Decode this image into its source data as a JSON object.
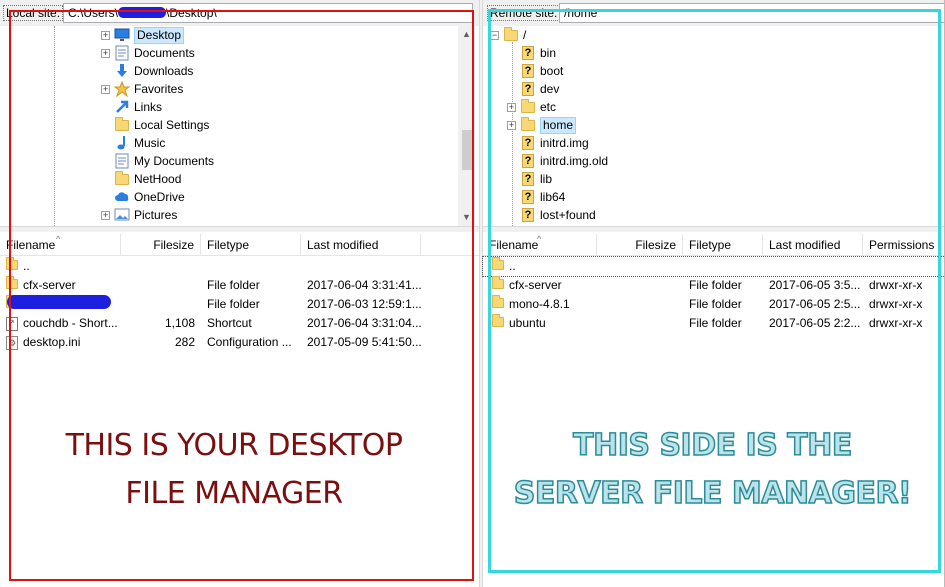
{
  "local": {
    "site_label": "Local site:",
    "path_prefix": "C:\\Users\\",
    "path_suffix": "\\Desktop\\",
    "tree": [
      {
        "label": "Desktop",
        "icon": "desktop-icon",
        "expandable": true,
        "selected": true
      },
      {
        "label": "Documents",
        "icon": "documents-icon",
        "expandable": true
      },
      {
        "label": "Downloads",
        "icon": "download-icon",
        "expandable": false
      },
      {
        "label": "Favorites",
        "icon": "star-icon",
        "expandable": true
      },
      {
        "label": "Links",
        "icon": "link-icon",
        "expandable": false
      },
      {
        "label": "Local Settings",
        "icon": "folder-icon",
        "expandable": false
      },
      {
        "label": "Music",
        "icon": "music-icon",
        "expandable": false
      },
      {
        "label": "My Documents",
        "icon": "documents-icon",
        "expandable": false
      },
      {
        "label": "NetHood",
        "icon": "folder-icon",
        "expandable": false
      },
      {
        "label": "OneDrive",
        "icon": "cloud-icon",
        "expandable": false
      },
      {
        "label": "Pictures",
        "icon": "pictures-icon",
        "expandable": true
      }
    ],
    "columns": [
      "Filename",
      "Filesize",
      "Filetype",
      "Last modified"
    ],
    "files": [
      {
        "name": "..",
        "size": "",
        "type": "",
        "modified": "",
        "icon": "folder-icon"
      },
      {
        "name": "cfx-server",
        "size": "",
        "type": "File folder",
        "modified": "2017-06-04 3:31:41...",
        "icon": "folder-icon"
      },
      {
        "name": "",
        "size": "",
        "type": "File folder",
        "modified": "2017-06-03 12:59:1...",
        "icon": "folder-icon"
      },
      {
        "name": "couchdb - Short...",
        "size": "1,108",
        "type": "Shortcut",
        "modified": "2017-06-04 3:31:04...",
        "icon": "shortcut-icon"
      },
      {
        "name": "desktop.ini",
        "size": "282",
        "type": "Configuration ...",
        "modified": "2017-05-09 5:41:50...",
        "icon": "settings-file-icon"
      }
    ],
    "caption_line1": "THIS IS YOUR DESKTOP",
    "caption_line2": "FILE MANAGER",
    "outline_color": "#e01010",
    "caption_color": "#7a0f10"
  },
  "remote": {
    "site_label": "Remote site:",
    "path": "/home",
    "tree_root": "/",
    "tree": [
      {
        "label": "bin",
        "icon": "unknown-folder-icon",
        "expandable": false
      },
      {
        "label": "boot",
        "icon": "unknown-folder-icon",
        "expandable": false
      },
      {
        "label": "dev",
        "icon": "unknown-folder-icon",
        "expandable": false
      },
      {
        "label": "etc",
        "icon": "folder-icon",
        "expandable": true
      },
      {
        "label": "home",
        "icon": "folder-icon",
        "expandable": true,
        "selected": true
      },
      {
        "label": "initrd.img",
        "icon": "unknown-folder-icon",
        "expandable": false
      },
      {
        "label": "initrd.img.old",
        "icon": "unknown-folder-icon",
        "expandable": false
      },
      {
        "label": "lib",
        "icon": "unknown-folder-icon",
        "expandable": false
      },
      {
        "label": "lib64",
        "icon": "unknown-folder-icon",
        "expandable": false
      },
      {
        "label": "lost+found",
        "icon": "unknown-folder-icon",
        "expandable": false
      }
    ],
    "columns": [
      "Filename",
      "Filesize",
      "Filetype",
      "Last modified",
      "Permissions"
    ],
    "files": [
      {
        "name": "..",
        "size": "",
        "type": "",
        "modified": "",
        "perms": "",
        "icon": "folder-icon"
      },
      {
        "name": "cfx-server",
        "size": "",
        "type": "File folder",
        "modified": "2017-06-05 3:5...",
        "perms": "drwxr-xr-x",
        "icon": "folder-icon"
      },
      {
        "name": "mono-4.8.1",
        "size": "",
        "type": "File folder",
        "modified": "2017-06-05 2:5...",
        "perms": "drwxr-xr-x",
        "icon": "folder-icon"
      },
      {
        "name": "ubuntu",
        "size": "",
        "type": "File folder",
        "modified": "2017-06-05 2:2...",
        "perms": "drwxr-xr-x",
        "icon": "folder-icon"
      }
    ],
    "caption_line1": "THIS SIDE IS THE",
    "caption_line2": "SERVER FILE MANAGER!",
    "outline_color": "#37d7df",
    "caption_color": "#2a8c99"
  }
}
